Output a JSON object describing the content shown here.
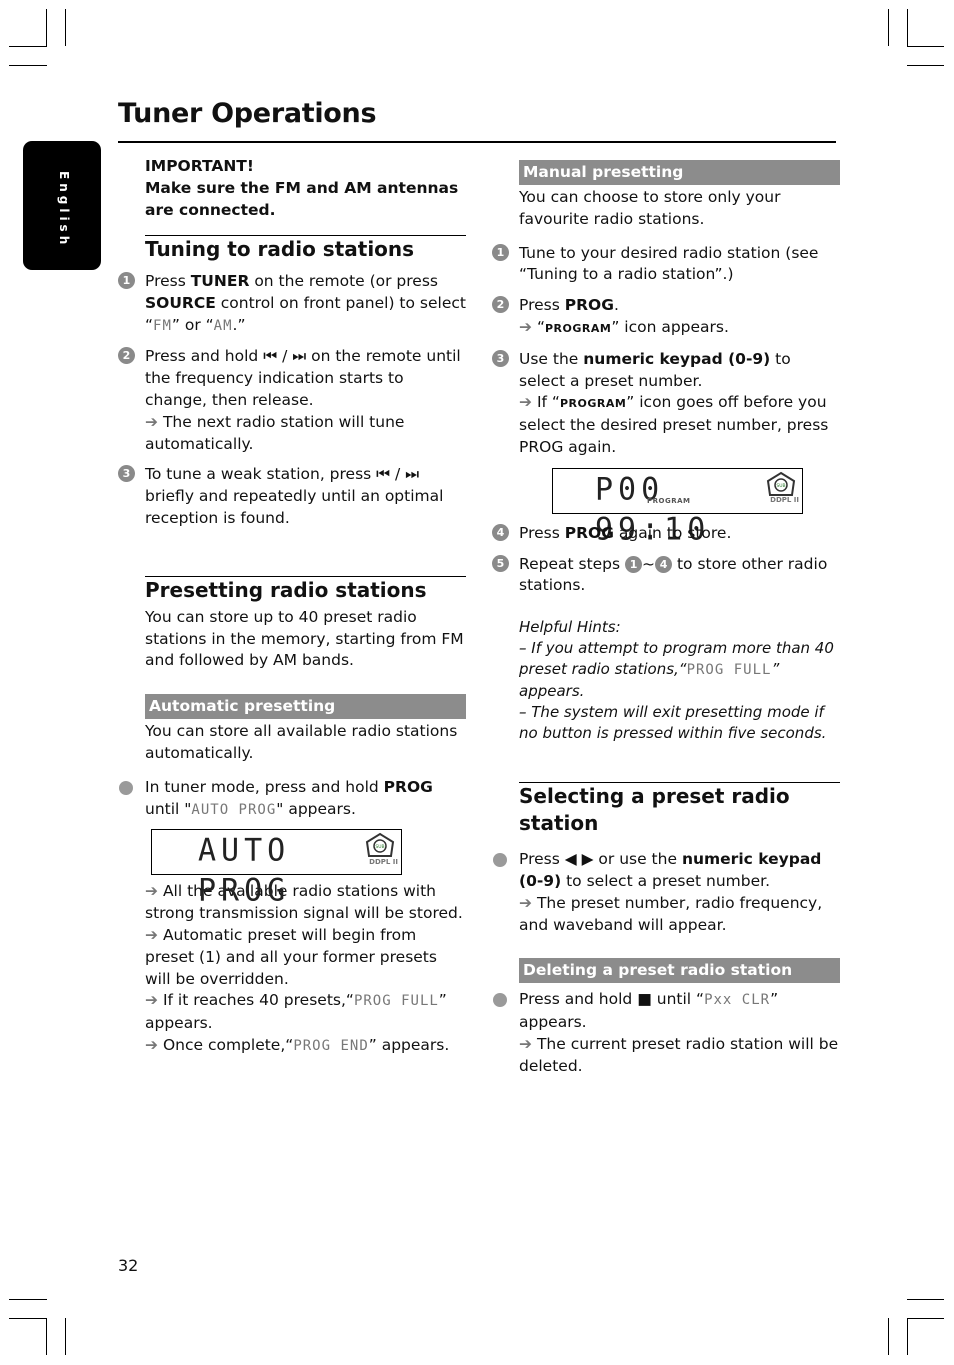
{
  "page": {
    "title": "Tuner Operations",
    "language_tab": "English",
    "page_number": "32"
  },
  "important": {
    "line1": "IMPORTANT!",
    "line2": "Make sure the FM and AM antennas are connected."
  },
  "tuning": {
    "heading": "Tuning to radio stations",
    "steps": [
      {
        "num": "1",
        "parts": [
          "Press ",
          "TUNER",
          " on the remote (or press ",
          "SOURCE",
          " control on front panel) to select “",
          "FM",
          "” or “",
          "AM",
          ".”"
        ]
      },
      {
        "num": "2",
        "text_a": "Press and hold ",
        "icons": "⏮ / ⏭",
        "text_b": " on the remote until the frequency indication starts to change, then release.",
        "result": "The next radio station will tune automatically."
      },
      {
        "num": "3",
        "text_a": "To tune a weak station, press ",
        "icons": "⏮ / ⏭",
        "text_b": " briefly and repeatedly until an optimal reception is found."
      }
    ]
  },
  "presetting": {
    "heading": "Presetting radio stations",
    "intro": "You can store up to 40 preset radio stations in the memory, starting from FM and followed by AM bands."
  },
  "automatic": {
    "heading": "Automatic presetting",
    "intro": "You can store all available radio stations automatically.",
    "step_a": "In tuner mode, press and hold ",
    "step_key": "PROG",
    "step_b": "until \"",
    "step_lcd": "AUTO PROG",
    "step_c": "\" appears.",
    "display": "AUTO PROG",
    "results": [
      "All the available radio stations with strong transmission signal will be stored.",
      "Automatic preset will begin from preset (1) and all your former presets will be overridden."
    ],
    "full_a": "If it reaches 40 presets,“",
    "full_lcd": "PROG FULL",
    "full_b": "” appears.",
    "end_a": "Once complete,“",
    "end_lcd": "PROG END",
    "end_b": "” appears."
  },
  "manual": {
    "heading": "Manual presetting",
    "intro": "You can choose to store only your favourite radio stations.",
    "step1": "Tune to your desired radio station (see “Tuning to a radio station”.)",
    "step2_a": "Press ",
    "step2_key": "PROG",
    "step2_b": ".",
    "step2_result_a": "“",
    "step2_icon": "PROGRAM",
    "step2_result_b": "” icon appears.",
    "step3_a": "Use the ",
    "step3_key": "numeric keypad (0-9)",
    "step3_b": " to select a preset number.",
    "step3_result_a": "If “",
    "step3_icon": "PROGRAM",
    "step3_result_b": "” icon goes off before you select the desired preset number, press PROG again.",
    "display": "P00 99:10",
    "display_label": "PROGRAM",
    "step4_a": "Press ",
    "step4_key": "PROG",
    "step4_b": " again to store.",
    "step5_a": "Repeat steps ",
    "step5_from": "1",
    "step5_tilde": "~",
    "step5_to": "4",
    "step5_b": " to store other radio stations.",
    "hints_title": "Helpful Hints:",
    "hint1_a": "–  If you attempt to program more than 40 preset radio stations,“",
    "hint1_lcd": "PROG FULL",
    "hint1_b": "” appears.",
    "hint2": "–  The system will exit presetting mode if no button is pressed within five seconds."
  },
  "selecting": {
    "heading": "Selecting a preset radio station",
    "step_a": "Press ◀ ▶ or use the ",
    "step_key": "numeric keypad (0-9)",
    "step_b": " to select a preset number.",
    "result": "The preset number, radio frequency, and waveband will appear."
  },
  "deleting": {
    "heading": "Deleting a preset radio station",
    "step_a": "Press and hold ",
    "step_icon": "■",
    "step_b": " until “",
    "step_lcd": "Pxx CLR",
    "step_c": "” appears.",
    "result": "The current preset radio station will be deleted."
  },
  "display_badges": {
    "sub": "SUB",
    "pl": "DDPL II"
  },
  "arrow": "➔"
}
